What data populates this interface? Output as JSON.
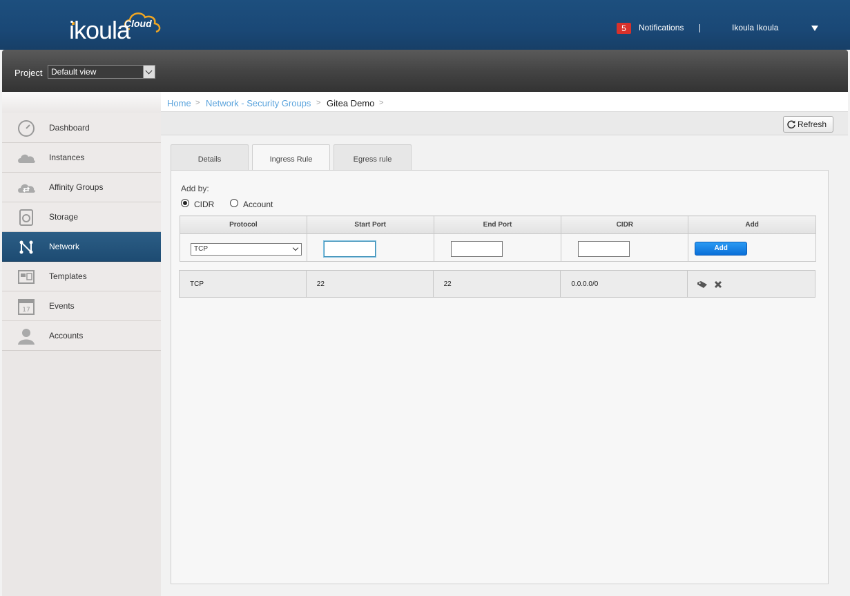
{
  "header": {
    "brand": "ikoula",
    "brand_sub": "Cloud",
    "notification_count": "5",
    "notifications_label": "Notifications",
    "user_name": "Ikoula Ikoula"
  },
  "project": {
    "label": "Project",
    "selected": "Default view"
  },
  "sidebar": {
    "items": [
      {
        "label": "Dashboard",
        "icon": "dashboard-icon"
      },
      {
        "label": "Instances",
        "icon": "cloud-icon"
      },
      {
        "label": "Affinity Groups",
        "icon": "affinity-icon"
      },
      {
        "label": "Storage",
        "icon": "storage-icon"
      },
      {
        "label": "Network",
        "icon": "network-icon"
      },
      {
        "label": "Templates",
        "icon": "templates-icon"
      },
      {
        "label": "Events",
        "icon": "calendar-icon",
        "day": "17"
      },
      {
        "label": "Accounts",
        "icon": "user-icon"
      }
    ]
  },
  "breadcrumb": {
    "home": "Home",
    "security_groups": "Network - Security Groups",
    "current": "Gitea Demo",
    "sep": ">"
  },
  "toolbar": {
    "refresh_label": "Refresh"
  },
  "tabs": {
    "details": "Details",
    "ingress": "Ingress Rule",
    "egress": "Egress rule"
  },
  "form": {
    "add_by_label": "Add by:",
    "cidr_option": "CIDR",
    "account_option": "Account",
    "headers": {
      "protocol": "Protocol",
      "start_port": "Start Port",
      "end_port": "End Port",
      "cidr": "CIDR",
      "add": "Add"
    },
    "protocol_selected": "TCP",
    "add_button": "Add"
  },
  "rules": [
    {
      "protocol": "TCP",
      "start_port": "22",
      "end_port": "22",
      "cidr": "0.0.0.0/0"
    }
  ]
}
